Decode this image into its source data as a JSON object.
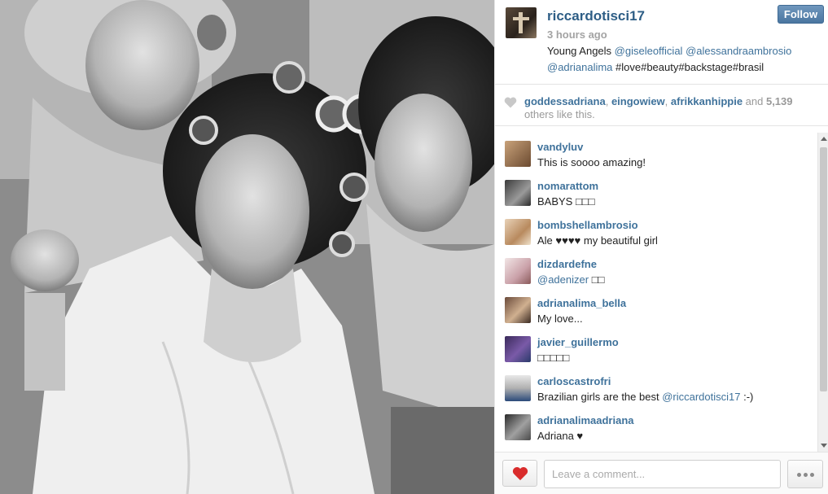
{
  "post": {
    "owner": "riccardotisci17",
    "follow_label": "Follow",
    "timestamp": "3 hours ago",
    "caption": {
      "text_start": "Young Angels ",
      "mention1": "@giseleofficial",
      "space1": " ",
      "mention2": "@alessandraambrosio",
      "space2": " ",
      "mention3": "@adrianalima",
      "hashtags": " #love#beauty#backstage#brasil"
    }
  },
  "likes": {
    "user1": "goddessadriana",
    "sep1": ", ",
    "user2": "eingowiew",
    "sep2": ", ",
    "user3": "afrikkanhippie",
    "and": " and ",
    "count": "5,139",
    "others": "others like this."
  },
  "comments": [
    {
      "user": "vandyluv",
      "text": "This is soooo amazing!"
    },
    {
      "user": "nomarattom",
      "text": "BABYS □□□"
    },
    {
      "user": "bombshellambrosio",
      "text": "Ale ♥♥♥♥ my beautiful girl"
    },
    {
      "user": "dizdardefne",
      "mention": "@adenizer",
      "text": " □□"
    },
    {
      "user": "adrianalima_bella",
      "text": "My love..."
    },
    {
      "user": "javier_guillermo",
      "text": "□□□□□"
    },
    {
      "user": "carloscastrofri",
      "text": "Brazilian girls are the best ",
      "mention": "@riccardotisci17",
      "text_end": " :-)"
    },
    {
      "user": "adrianalimaadriana",
      "text": "Adriana ♥"
    }
  ],
  "footer": {
    "comment_placeholder": "Leave a comment..."
  },
  "colors": {
    "link": "#3f729b",
    "like_heart": "#d92c2c",
    "follow_button": "#517fa4"
  },
  "icons": {
    "likes": "heart-icon",
    "like_button": "heart-icon",
    "more": "ellipsis-icon"
  }
}
